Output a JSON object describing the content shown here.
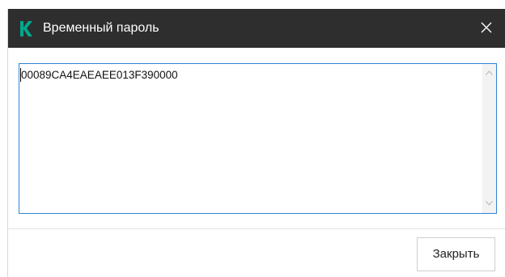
{
  "dialog": {
    "title": "Временный пароль",
    "logo_letter": "k",
    "close_icon": "close-icon"
  },
  "password_field": {
    "value": "00089CA4EAEAEE013F390000"
  },
  "footer": {
    "close_label": "Закрыть"
  },
  "colors": {
    "titlebar_bg": "#2e2e2e",
    "logo_accent": "#00a88e",
    "focus_border": "#2f84d6"
  }
}
